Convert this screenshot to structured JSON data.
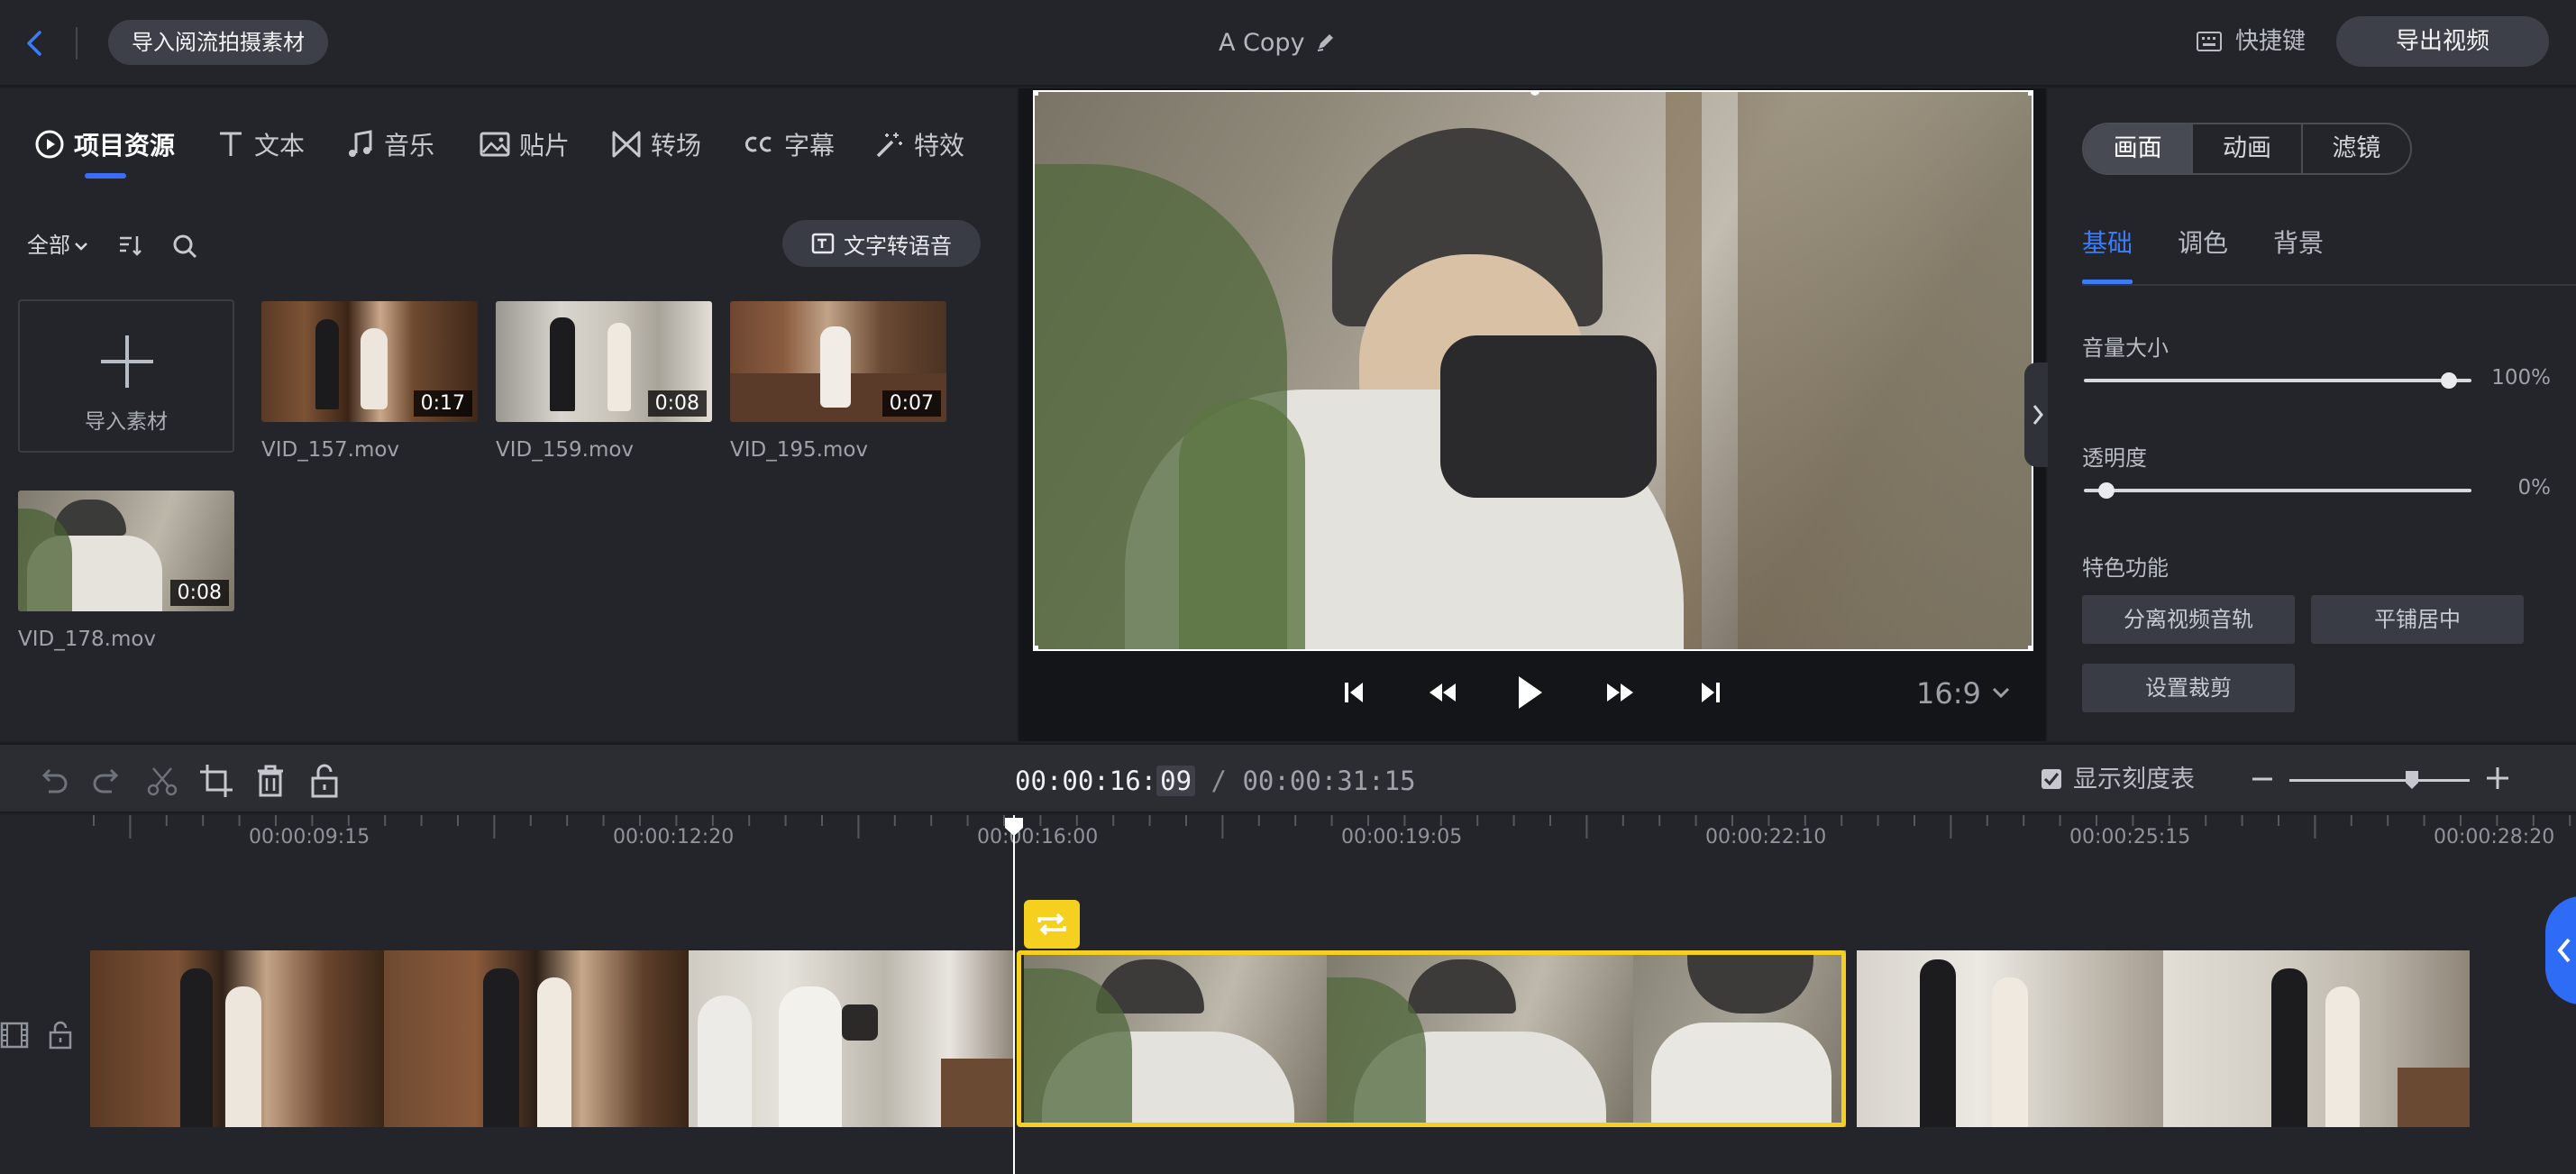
{
  "topbar": {
    "import_stream_label": "导入阅流拍摄素材",
    "project_title": "A Copy",
    "shortcut_label": "快捷键",
    "export_label": "导出视频"
  },
  "left_panel": {
    "tabs": [
      {
        "label": "项目资源",
        "icon": "play-circle-icon",
        "active": true
      },
      {
        "label": "文本",
        "icon": "text-icon"
      },
      {
        "label": "音乐",
        "icon": "music-note-icon"
      },
      {
        "label": "贴片",
        "icon": "image-icon"
      },
      {
        "label": "转场",
        "icon": "transition-icon"
      },
      {
        "label": "字幕",
        "icon": "cc-icon"
      },
      {
        "label": "特效",
        "icon": "magic-wand-icon"
      }
    ],
    "filter_label": "全部",
    "tts_label": "文字转语音",
    "import_label": "导入素材",
    "clips": [
      {
        "name": "VID_157.mov",
        "duration": "0:17"
      },
      {
        "name": "VID_159.mov",
        "duration": "0:08"
      },
      {
        "name": "VID_195.mov",
        "duration": "0:07"
      },
      {
        "name": "VID_178.mov",
        "duration": "0:08"
      }
    ]
  },
  "preview": {
    "aspect_ratio": "16:9"
  },
  "right_panel": {
    "segments": [
      "画面",
      "动画",
      "滤镜"
    ],
    "sub_tabs": [
      "基础",
      "调色",
      "背景"
    ],
    "volume_label": "音量大小",
    "volume_value": "100%",
    "volume_level": 1.0,
    "opacity_label": "透明度",
    "opacity_value": "0%",
    "opacity_level": 0.0,
    "features_label": "特色功能",
    "feature_buttons": [
      "分离视频音轨",
      "平铺居中",
      "设置裁剪"
    ]
  },
  "timeline": {
    "current_time_main": "00:00:16:",
    "current_time_frame": "09",
    "separator": "/",
    "total_time": "00:00:31:15",
    "show_scale_label": "显示刻度表",
    "ruler_labels": [
      "00:00:09:15",
      "00:00:12:20",
      "00:00:16:00",
      "00:00:19:05",
      "00:00:22:10",
      "00:00:25:15",
      "00:00:28:20"
    ]
  },
  "colors": {
    "accent": "#3b6df6",
    "selection": "#f5d01f",
    "panel_bg": "#23252b"
  }
}
